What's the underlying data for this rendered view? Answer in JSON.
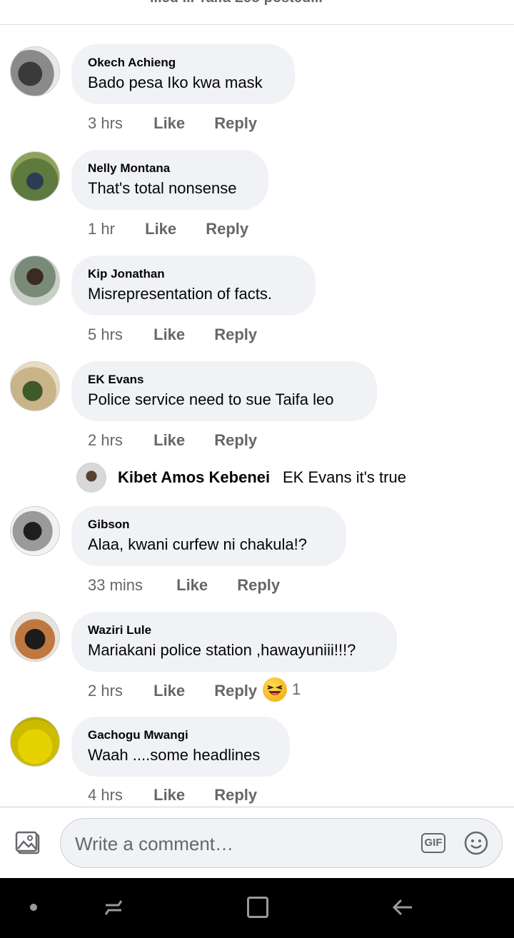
{
  "header": {
    "cut_text": "...ed ... Taifa Leo posted..."
  },
  "comments": [
    {
      "author": "Okech Achieng",
      "text": "Bado pesa Iko kwa mask",
      "time": "3 hrs",
      "like": "Like",
      "reply": "Reply"
    },
    {
      "author": "Nelly Montana",
      "text": "That's total nonsense",
      "time": "1 hr",
      "like": "Like",
      "reply": "Reply"
    },
    {
      "author": "Kip Jonathan",
      "text": "Misrepresentation of facts.",
      "time": "5 hrs",
      "like": "Like",
      "reply": "Reply"
    },
    {
      "author": "EK Evans",
      "text": "Police service need to sue Taifa leo",
      "time": "2 hrs",
      "like": "Like",
      "reply": "Reply",
      "reply_preview": {
        "author": "Kibet Amos Kebenei",
        "text": "EK Evans it's true"
      }
    },
    {
      "author": "Gibson",
      "text": "Alaa, kwani curfew ni chakula!?",
      "time": "33 mins",
      "like": "Like",
      "reply": "Reply"
    },
    {
      "author": "Waziri Lule",
      "text": "Mariakani police station ,hawayuniii!!!?",
      "time": "2 hrs",
      "like": "Like",
      "reply": "Reply",
      "reaction": {
        "icon": "laughing-emoji-icon",
        "count": "1"
      }
    },
    {
      "author": "Gachogu Mwangi",
      "text": "Waah ....some headlines",
      "time": "4 hrs",
      "like": "Like",
      "reply": "Reply"
    }
  ],
  "composer": {
    "placeholder": "Write a comment…",
    "gif_label": "GIF"
  }
}
